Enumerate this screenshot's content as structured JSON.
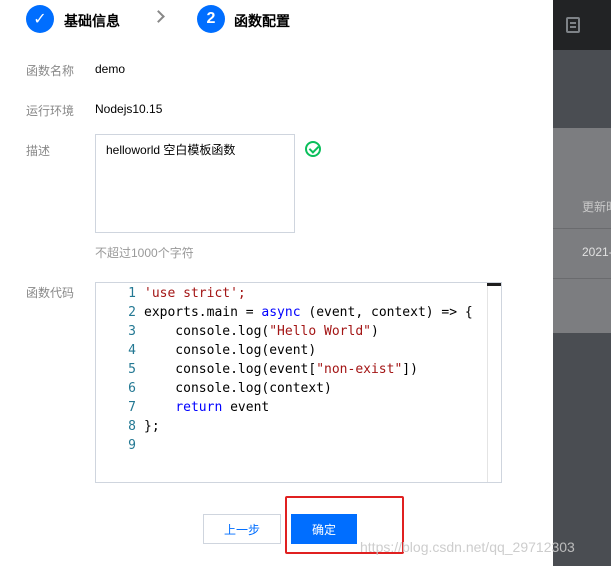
{
  "steps": [
    {
      "number": "✓",
      "label": "基础信息"
    },
    {
      "number": "2",
      "label": "函数配置"
    }
  ],
  "form": {
    "name": {
      "label": "函数名称",
      "value": "demo"
    },
    "runtime": {
      "label": "运行环境",
      "value": "Nodejs10.15"
    },
    "description": {
      "label": "描述",
      "value": "helloworld 空白模板函数",
      "hint": "不超过1000个字符"
    },
    "code": {
      "label": "函数代码",
      "line_numbers": [
        "1",
        "2",
        "3",
        "4",
        "5",
        "6",
        "7",
        "8",
        "9"
      ],
      "lines": [
        "'use strict';",
        "exports.main = async (event, context) => {",
        "    console.log(\"Hello World\")",
        "    console.log(event)",
        "    console.log(event[\"non-exist\"])",
        "    console.log(context)",
        "    return event",
        "};",
        ""
      ]
    }
  },
  "buttons": {
    "prev": "上一步",
    "confirm": "确定"
  },
  "background": {
    "table_header": "更新时",
    "table_cell": "2021-"
  },
  "watermark": "https://blog.csdn.net/qq_29712303",
  "colors": {
    "primary": "#006eff",
    "success": "#0abf5b",
    "highlight": "#e02020"
  },
  "icons": [
    "check-icon",
    "chevron-right-icon",
    "document-icon",
    "checkmark-circle-icon"
  ]
}
